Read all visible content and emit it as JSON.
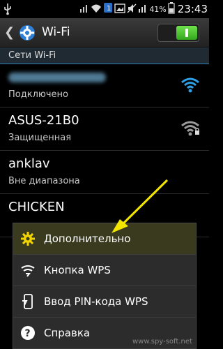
{
  "status_bar": {
    "icons": [
      "usb-icon",
      "signal-icon",
      "wifi-icon",
      "notification-icon",
      "image-icon",
      "mute-icon",
      "mobile-signal-icon"
    ],
    "battery_text": "41%",
    "time": "23:43"
  },
  "action_bar": {
    "title": "Wi-Fi",
    "toggle_state": "on",
    "accent_color": "#4cd433"
  },
  "section": {
    "title": "Сети Wi-Fi"
  },
  "networks": [
    {
      "name": "",
      "status": "Подключено",
      "signal": "strong",
      "name_obscured": true
    },
    {
      "name": "ASUS-21B0",
      "status": "Защищенная",
      "signal": "strong-gray"
    },
    {
      "name": "anklav",
      "status": "Вне диапазона"
    },
    {
      "name": "CHICKEN",
      "status": ""
    }
  ],
  "menu": {
    "items": [
      {
        "label": "Дополнительно",
        "icon": "gear-icon",
        "highlighted": true
      },
      {
        "label": "Кнопка WPS",
        "icon": "wps-icon"
      },
      {
        "label": "Ввод PIN-кода WPS",
        "icon": "pin-wps-icon"
      },
      {
        "label": "Справка",
        "icon": "help-icon"
      }
    ]
  },
  "annotation": {
    "type": "arrow",
    "color": "#f2e600",
    "points_to": "menu.items.0"
  },
  "watermark": "www.spy-soft.net"
}
